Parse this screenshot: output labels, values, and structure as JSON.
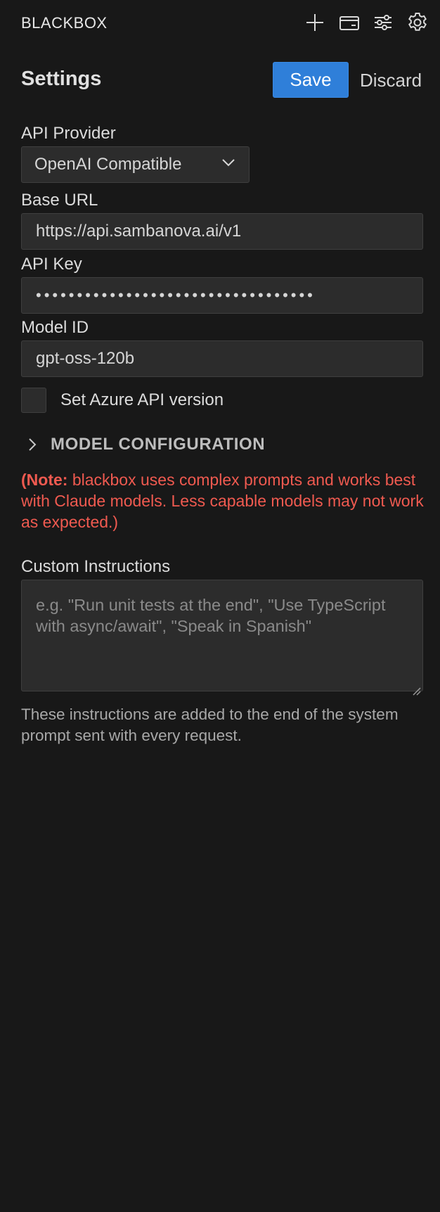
{
  "header": {
    "app_title": "BLACKBOX",
    "icons": [
      "plus-icon",
      "wallet-icon",
      "sliders-icon",
      "gear-icon"
    ]
  },
  "settings": {
    "title": "Settings",
    "save_label": "Save",
    "discard_label": "Discard"
  },
  "form": {
    "api_provider": {
      "label": "API Provider",
      "value": "OpenAI Compatible"
    },
    "base_url": {
      "label": "Base URL",
      "value": "https://api.sambanova.ai/v1"
    },
    "api_key": {
      "label": "API Key",
      "masked_value": "••••••••••••••••••••••••••••••••••"
    },
    "model_id": {
      "label": "Model ID",
      "value": "gpt-oss-120b"
    },
    "azure_checkbox": {
      "label": "Set Azure API version",
      "checked": false
    },
    "model_configuration": {
      "label": "MODEL CONFIGURATION",
      "expanded": false
    },
    "note": {
      "prefix": "(Note:",
      "text": " blackbox uses complex prompts and works best with Claude models. Less capable models may not work as expected.)"
    },
    "custom_instructions": {
      "label": "Custom Instructions",
      "placeholder": "e.g. \"Run unit tests at the end\", \"Use TypeScript with async/await\", \"Speak in Spanish\"",
      "value": ""
    },
    "help_text": "These instructions are added to the end of the system prompt sent with every request."
  },
  "colors": {
    "background": "#181818",
    "accent": "#2f7fd9",
    "note": "#f05a50",
    "field_bg": "#2c2c2c"
  }
}
